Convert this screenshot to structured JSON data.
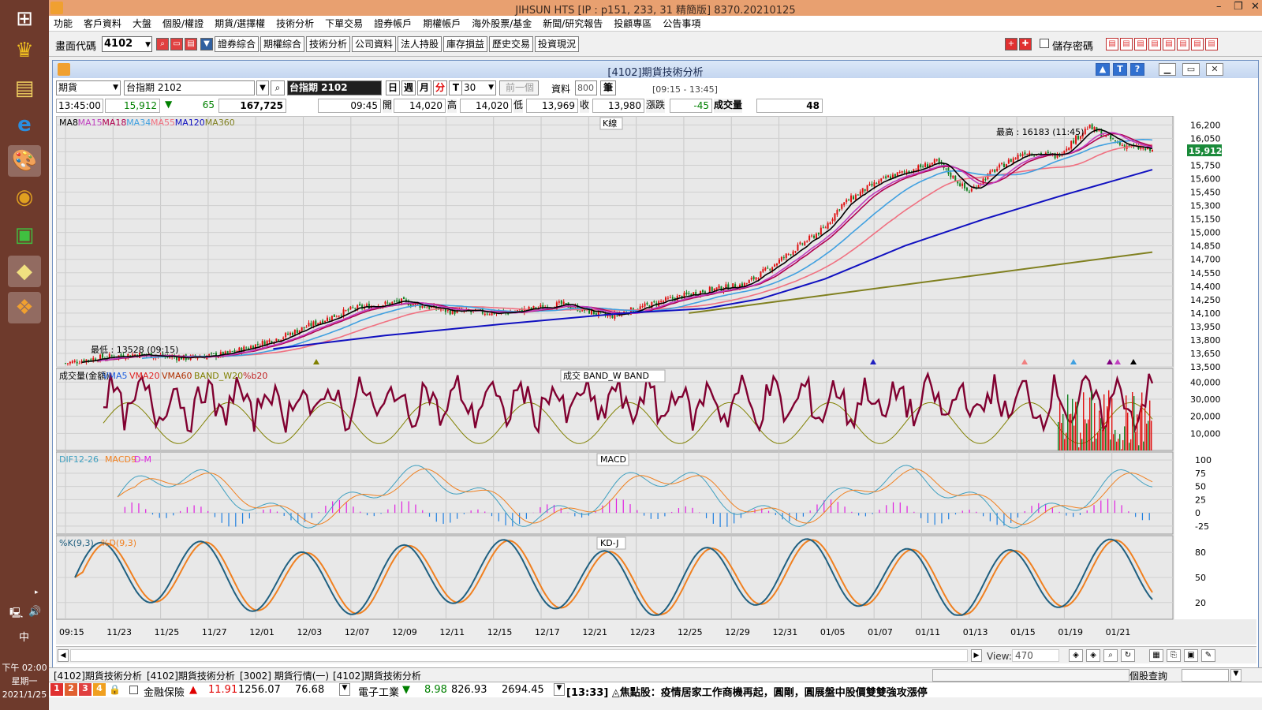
{
  "window": {
    "title": "JIHSUN HTS     [IP : p151, 233, 31 精簡版] 8370.20210125"
  },
  "menu": [
    "功能",
    "客戶資料",
    "大盤",
    "個股/權證",
    "期貨/選擇權",
    "技術分析",
    "下單交易",
    "證券帳戶",
    "期權帳戶",
    "海外股票/基金",
    "新聞/研究報告",
    "投顧專區",
    "公告事項"
  ],
  "toolbar": {
    "code_label": "畫面代碼",
    "code_value": "4102",
    "buttons": [
      "證券綜合",
      "期權綜合",
      "技術分析",
      "公司資料",
      "法人持股",
      "庫存損益",
      "歷史交易",
      "投資現況"
    ],
    "save_pw": "儲存密碼"
  },
  "child": {
    "title": "[4102]期貨技術分析",
    "type_select": "期貨",
    "symbol_select": "台指期 2102",
    "symbol_display": "台指期 2102",
    "period_buttons": [
      "日",
      "週",
      "月",
      "分",
      "T"
    ],
    "minute_value": "30",
    "prev_btn": "前一個",
    "data_label": "資料",
    "data_count": "800",
    "data_unit": "筆",
    "session": "[09:15 - 13:45]",
    "quote": {
      "time": "13:45:00",
      "price": "15,912",
      "change": "65",
      "volume_total": "167,725",
      "bar_time": "09:45",
      "open_lbl": "開",
      "open": "14,020",
      "high_lbl": "高",
      "high": "14,020",
      "low_lbl": "低",
      "low": "13,969",
      "close_lbl": "收",
      "close": "13,980",
      "chg_lbl": "漲跌",
      "chg": "-45",
      "vol_lbl": "成交量",
      "vol": "48"
    }
  },
  "chart_data": [
    {
      "type": "line",
      "title": "K線",
      "series": [
        {
          "name": "MA8"
        },
        {
          "name": "MA15"
        },
        {
          "name": "MA18"
        },
        {
          "name": "MA34"
        },
        {
          "name": "MA55"
        },
        {
          "name": "MA120"
        },
        {
          "name": "MA360"
        }
      ],
      "series_colors": [
        "#000000",
        "#c040c0",
        "#b00050",
        "#40a0e0",
        "#f07080",
        "#1010c0",
        "#808020"
      ],
      "y_ticks": [
        16200,
        16050,
        15900,
        15750,
        15600,
        15450,
        15300,
        15150,
        15000,
        14850,
        14700,
        14550,
        14400,
        14250,
        14100,
        13950,
        13800,
        13650,
        13500
      ],
      "ylim": [
        13500,
        16300
      ],
      "last_price": "15,912",
      "annotations": {
        "high": "最高 : 16183 (11:45)",
        "low": "最低 : 13528 (09:15)"
      },
      "x_labels": [
        "09:15",
        "11/23",
        "11/25",
        "11/27",
        "12/01",
        "12/03",
        "12/07",
        "12/09",
        "12/11",
        "12/15",
        "12/17",
        "12/21",
        "12/23",
        "12/25",
        "12/29",
        "12/31",
        "01/05",
        "01/07",
        "01/11",
        "01/13",
        "01/15",
        "01/19",
        "01/21"
      ],
      "trend": [
        [
          0,
          13540
        ],
        [
          0.04,
          13600
        ],
        [
          0.09,
          13640
        ],
        [
          0.15,
          13600
        ],
        [
          0.2,
          13640
        ],
        [
          0.27,
          13830
        ],
        [
          0.31,
          13980
        ],
        [
          0.36,
          14150
        ],
        [
          0.42,
          14230
        ],
        [
          0.48,
          14120
        ],
        [
          0.55,
          14100
        ],
        [
          0.62,
          14200
        ],
        [
          0.68,
          14060
        ],
        [
          0.75,
          14240
        ],
        [
          0.8,
          14350
        ],
        [
          0.85,
          14420
        ],
        [
          0.88,
          14600
        ],
        [
          0.92,
          14860
        ],
        [
          0.95,
          15050
        ],
        [
          0.97,
          15300
        ],
        [
          1.0,
          15480
        ],
        [
          1.03,
          15620
        ],
        [
          1.06,
          15700
        ],
        [
          1.09,
          15790
        ],
        [
          1.13,
          15450
        ],
        [
          1.16,
          15680
        ],
        [
          1.2,
          15900
        ],
        [
          1.24,
          15850
        ],
        [
          1.28,
          16180
        ],
        [
          1.32,
          15980
        ],
        [
          1.36,
          15910
        ]
      ],
      "ma120": [
        [
          0.26,
          13700
        ],
        [
          0.4,
          13850
        ],
        [
          0.55,
          13980
        ],
        [
          0.7,
          14100
        ],
        [
          0.8,
          14150
        ],
        [
          0.87,
          14260
        ],
        [
          0.95,
          14480
        ],
        [
          1.05,
          14850
        ],
        [
          1.15,
          15150
        ],
        [
          1.25,
          15420
        ],
        [
          1.36,
          15700
        ]
      ],
      "ma360": [
        [
          0.78,
          14100
        ],
        [
          1.36,
          14780
        ]
      ]
    },
    {
      "type": "line",
      "title": "成交  BAND_W  BAND",
      "series": [
        {
          "name": "成交量(金額)"
        },
        {
          "name": "VMA5"
        },
        {
          "name": "VMA20"
        },
        {
          "name": "VMA60"
        },
        {
          "name": "BAND_W20"
        },
        {
          "name": "%b20"
        }
      ],
      "series_colors": [
        "#000000",
        "#2060e0",
        "#e02020",
        "#b03000",
        "#808000",
        "#c02020"
      ],
      "y_ticks": [
        40000,
        30000,
        20000,
        10000
      ],
      "ylim": [
        0,
        48000
      ]
    },
    {
      "type": "bar",
      "title": "MACD",
      "series": [
        {
          "name": "DIF12-26"
        },
        {
          "name": "MACD9"
        },
        {
          "name": "D-M"
        }
      ],
      "series_colors": [
        "#40a0c0",
        "#f08020",
        "#e020e0"
      ],
      "y_ticks": [
        100,
        75,
        50,
        25,
        0,
        -25
      ],
      "ylim": [
        -40,
        115
      ]
    },
    {
      "type": "line",
      "title": "KD-J",
      "series": [
        {
          "name": "%K(9,3)"
        },
        {
          "name": "%D(9,3)"
        }
      ],
      "series_colors": [
        "#206080",
        "#f08020"
      ],
      "y_ticks": [
        80,
        50,
        20
      ],
      "ylim": [
        0,
        100
      ]
    }
  ],
  "view": {
    "label": "View:",
    "value": "470"
  },
  "tabs": [
    "[4102]期貨技術分析",
    "[4102]期貨技術分析",
    "[3002] 期貨行情(一)",
    "[4102]期貨技術分析"
  ],
  "tabs_right": "個股查詢",
  "ticker": {
    "item1_name": "金融保險",
    "item1_chg": "11.91",
    "item1_val": "1256.07",
    "item1_x": "76.68",
    "item2_name": "電子工業",
    "item2_chg": "8.98",
    "item2_val": "826.93",
    "item2_x": "2694.45",
    "news": "[13:33] ◬焦點股：疫情居家工作商機再起，圓剛，圓展盤中股價雙雙強攻漲停"
  },
  "taskbar": {
    "time": "下午 02:00",
    "weekday": "星期一",
    "date": "2021/1/25",
    "ime": "中"
  }
}
